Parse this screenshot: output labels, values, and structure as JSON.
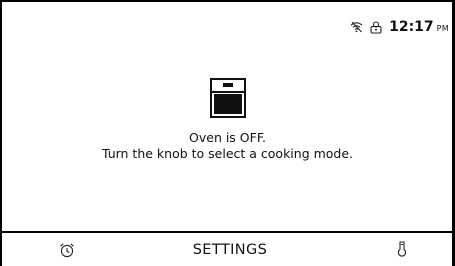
{
  "status_bar": {
    "wifi_icon": "wifi-off-icon",
    "remote_icon": "remote-control-icon",
    "time": "12:17",
    "ampm": "PM"
  },
  "main": {
    "icon": "oven-icon",
    "message_line1": "Oven is OFF.",
    "message_line2": "Turn the knob to select a cooking mode."
  },
  "bottom_bar": {
    "timer_icon": "alarm-clock-icon",
    "settings_label": "SETTINGS",
    "probe_icon": "meat-probe-icon"
  },
  "colors": {
    "background": "#ffffff",
    "foreground": "#111111",
    "frame": "#000000"
  }
}
